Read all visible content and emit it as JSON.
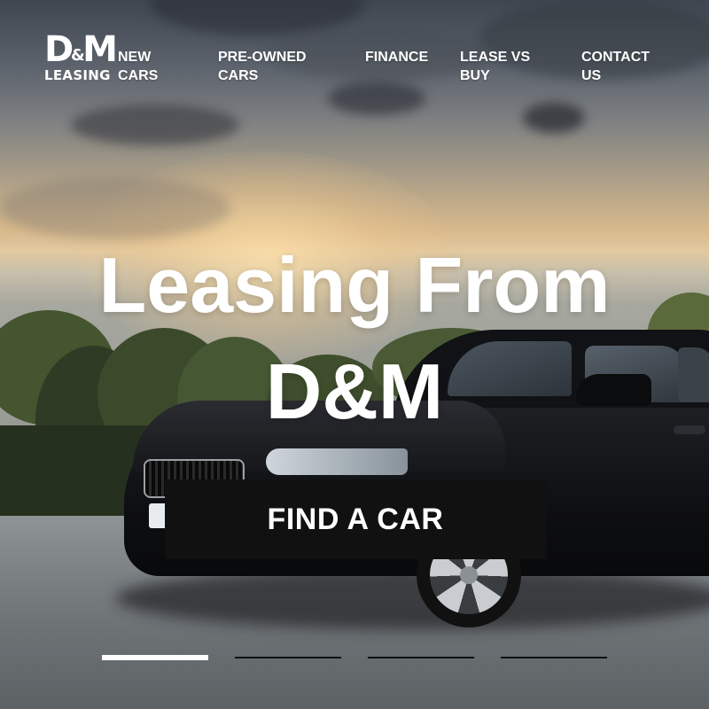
{
  "logo": {
    "main": "D M",
    "ampersand": "&",
    "sub": "LEASING"
  },
  "nav": {
    "items": [
      {
        "label": "NEW\nCARS"
      },
      {
        "label": "PRE-OWNED\nCARS"
      },
      {
        "label": "FINANCE"
      },
      {
        "label": "LEASE VS\nBUY"
      },
      {
        "label": "CONTACT\nUS"
      }
    ]
  },
  "hero": {
    "headline": "Leasing From\nD&M",
    "cta_label": "FIND A CAR"
  },
  "slider": {
    "count": 4,
    "active_index": 0
  },
  "colors": {
    "cta_bg": "#111111",
    "text": "#ffffff",
    "indicator_active": "#ffffff",
    "indicator_inactive": "#111111"
  }
}
